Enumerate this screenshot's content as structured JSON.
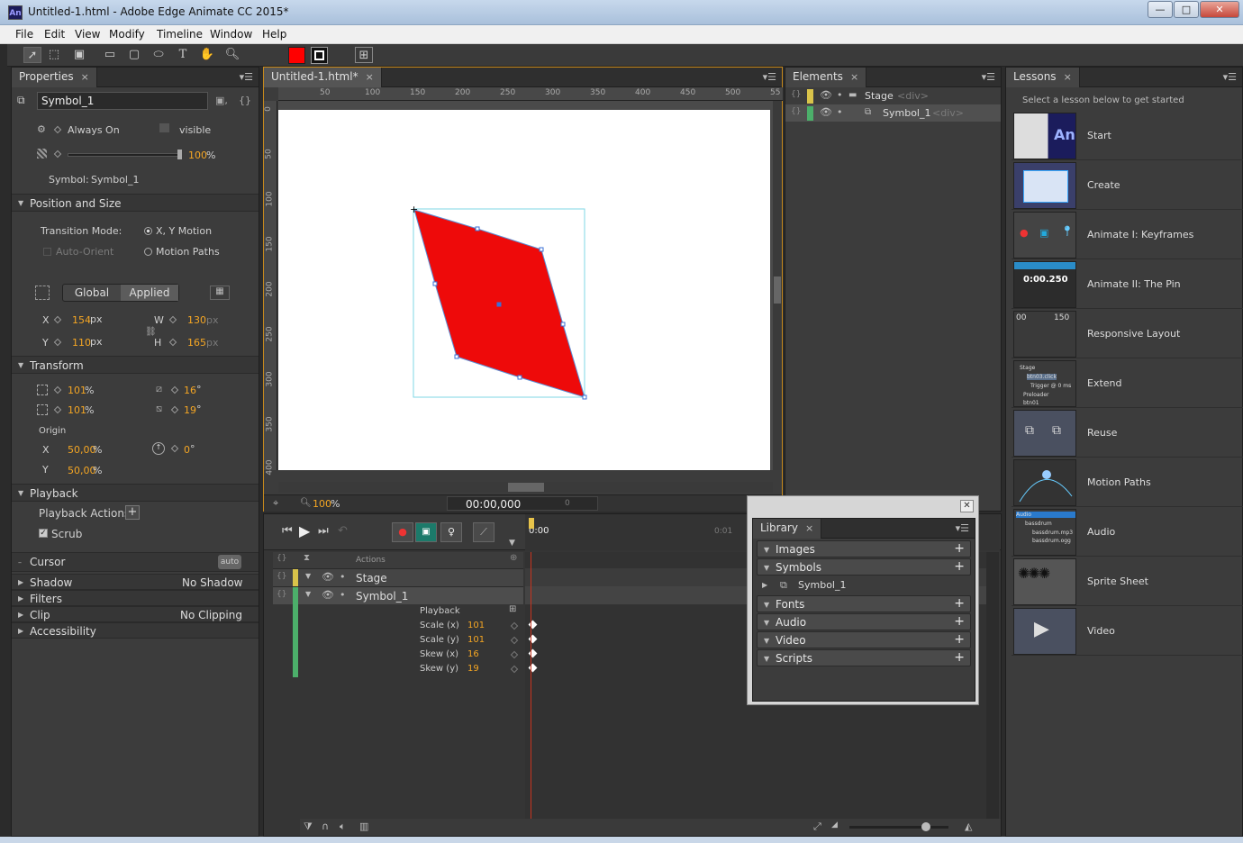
{
  "window": {
    "title": "Untitled-1.html - Adobe Edge Animate CC 2015*",
    "app_icon": "An",
    "controls": {
      "minimize": "—",
      "maximize": "□",
      "close": "✕"
    }
  },
  "menu": [
    "File",
    "Edit",
    "View",
    "Modify",
    "Timeline",
    "Window",
    "Help"
  ],
  "toolbar": {
    "tools": [
      "arrow-icon",
      "transform-icon",
      "clipping-icon",
      "rectangle-icon",
      "rounded-rectangle-icon",
      "ellipse-icon",
      "text-icon",
      "hand-icon",
      "zoom-icon"
    ],
    "fill_color": "#ff0000",
    "stroke_color": "#000000"
  },
  "properties": {
    "tab": "Properties",
    "element_name": "Symbol_1",
    "display": "Always On",
    "overflow": "visible",
    "opacity_value": "100",
    "opacity_unit": "%",
    "symbol_label": "Symbol:",
    "symbol_name": "Symbol_1",
    "section_position": "Position and Size",
    "transition_mode_label": "Transition Mode:",
    "transition_xy": "X, Y Motion",
    "transition_paths": "Motion Paths",
    "auto_orient": "Auto-Orient",
    "global": "Global",
    "applied": "Applied",
    "x_label": "X",
    "x_value": "154",
    "y_label": "Y",
    "y_value": "110",
    "px": "px",
    "w_label": "W",
    "w_value": "130",
    "h_label": "H",
    "h_value": "165",
    "section_transform": "Transform",
    "scale_x": "101",
    "scale_y": "101",
    "skew_x": "16",
    "skew_y": "19",
    "pct": "%",
    "deg": "°",
    "origin_label": "Origin",
    "origin_x_label": "X",
    "origin_x": "50,00",
    "origin_y_label": "Y",
    "origin_y": "50,00",
    "rotation": "0",
    "section_playback": "Playback",
    "playback_actions": "Playback Actions",
    "scrub": "Scrub",
    "cursor": "Cursor",
    "cursor_value": "auto",
    "shadow": "Shadow",
    "shadow_value": "No Shadow",
    "filters": "Filters",
    "clip": "Clip",
    "clip_value": "No Clipping",
    "accessibility": "Accessibility"
  },
  "stage": {
    "tab": "Untitled-1.html*",
    "ruler_h": [
      "50",
      "100",
      "150",
      "200",
      "250",
      "300",
      "350",
      "400",
      "450",
      "500",
      "55"
    ],
    "ruler_v": [
      "0",
      "50",
      "100",
      "150",
      "200",
      "250",
      "300",
      "350",
      "400"
    ],
    "zoom": "100",
    "zoom_unit": "%",
    "timecode": "00:00,000",
    "scroll_value": "0",
    "shape_color": "#ee0a0a"
  },
  "elements": {
    "tab": "Elements",
    "rows": [
      {
        "name": "Stage",
        "tag": "<div>"
      },
      {
        "name": "Symbol_1",
        "tag": "<div>"
      }
    ]
  },
  "lessons": {
    "tab": "Lessons",
    "intro": "Select a lesson below to get started",
    "items": [
      "Start",
      "Create",
      "Animate I: Keyframes",
      "Animate II: The Pin",
      "Responsive Layout",
      "Extend",
      "Reuse",
      "Motion Paths",
      "Audio",
      "Sprite Sheet",
      "Video"
    ],
    "thumb_texts": {
      "start": "An",
      "pin_time": "0:00.250",
      "responsive_a": "00",
      "responsive_b": "150",
      "extend_lines": [
        "Stage",
        "btn03.click",
        "Trigger @ 0 ms",
        "Preloader",
        "btn01"
      ],
      "audio_lines": [
        "Audio",
        "bassdrum",
        "bassdrum.mp3",
        "bassdrum.ogg"
      ]
    }
  },
  "timeline": {
    "actions": "Actions",
    "time_start": "0:00",
    "time_next": "0:01",
    "rows": [
      {
        "label": "Stage"
      },
      {
        "label": "Symbol_1"
      }
    ],
    "props": [
      {
        "label": "Playback",
        "value": ""
      },
      {
        "label": "Scale (x)",
        "value": "101"
      },
      {
        "label": "Scale (y)",
        "value": "101"
      },
      {
        "label": "Skew (x)",
        "value": "16"
      },
      {
        "label": "Skew (y)",
        "value": "19"
      }
    ]
  },
  "library": {
    "tab": "Library",
    "items": [
      "Images",
      "Symbols",
      "Fonts",
      "Audio",
      "Video",
      "Scripts"
    ],
    "symbol_child": "Symbol_1"
  },
  "icons": {
    "panel_menu": "▾☰",
    "close": "×",
    "plus": "+",
    "expand": "▸",
    "collapse": "▾"
  }
}
